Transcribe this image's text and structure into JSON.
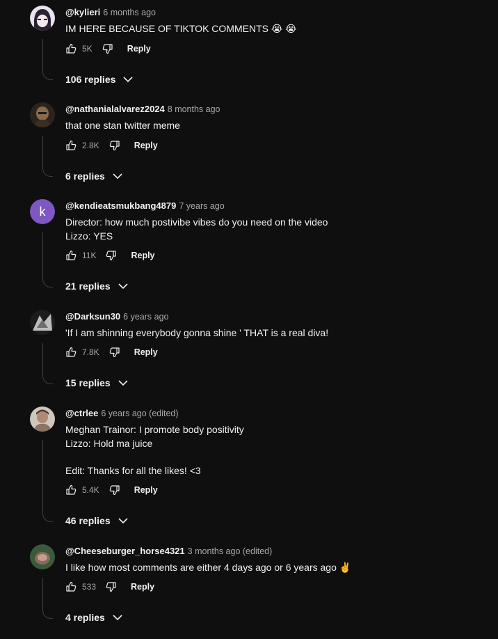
{
  "comments": [
    {
      "author": "@kylieri",
      "time": "6 months ago",
      "text": "IM HERE BECAUSE OF TIKTOK COMMENTS 😭 😭",
      "likes": "5K",
      "reply_label": "Reply",
      "replies_label": "106 replies",
      "avatar_color": "#d9d4e6"
    },
    {
      "author": "@nathanialalvarez2024",
      "time": "8 months ago",
      "text": "that one stan twitter meme",
      "likes": "2.8K",
      "reply_label": "Reply",
      "replies_label": "6 replies",
      "avatar_color": "#5a4a3a"
    },
    {
      "author": "@kendieatsmukbang4879",
      "time": "7 years ago",
      "text": "Director: how much postivibe vibes do you need on the video\nLizzo: YES",
      "likes": "11K",
      "reply_label": "Reply",
      "replies_label": "21 replies",
      "avatar_color": "#7e57c2",
      "avatar_letter": "k"
    },
    {
      "author": "@Darksun30",
      "time": "6 years ago",
      "text": "'If I am shinning everybody gonna shine ' THAT is a real diva!",
      "likes": "7.8K",
      "reply_label": "Reply",
      "replies_label": "15 replies",
      "avatar_color": "#9a9a9a"
    },
    {
      "author": "@ctrlee",
      "time": "6 years ago (edited)",
      "text": "Meghan Trainor: I promote body positivity\nLizzo: Hold ma juice\n\nEdit: Thanks for all the likes! <3",
      "likes": "5.4K",
      "reply_label": "Reply",
      "replies_label": "46 replies",
      "avatar_color": "#b79a86"
    },
    {
      "author": "@Cheeseburger_horse4321",
      "time": "3 months ago (edited)",
      "text": "I like how most comments are either 4 days ago or 6 years ago ✌️",
      "likes": "533",
      "reply_label": "Reply",
      "replies_label": "4 replies",
      "avatar_color": "#6f5a50"
    }
  ],
  "icons": {
    "like": "thumbs-up-icon",
    "dislike": "thumbs-down-icon",
    "expand": "chevron-down-icon"
  }
}
